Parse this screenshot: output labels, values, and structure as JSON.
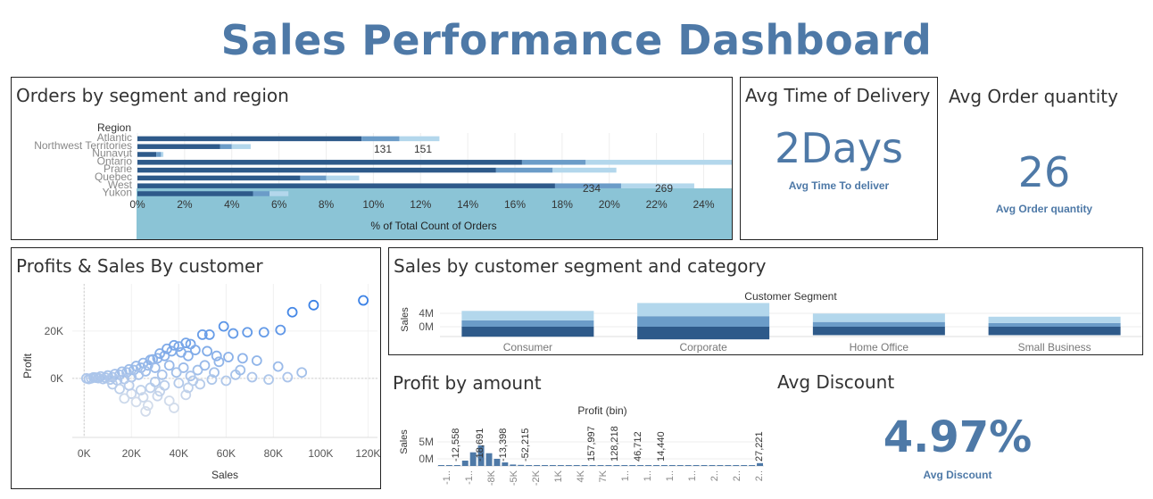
{
  "dashboard": {
    "title": "Sales Performance Dashboard"
  },
  "colors": {
    "title": "#4e79a7",
    "dark": "#2e5a8a",
    "mid": "#6b9cc8",
    "light": "#b3d7ec",
    "highlight": "#8bc4d6"
  },
  "orders_panel": {
    "title": "Orders by segment and region",
    "header": "Region",
    "axis_title": "% of Total Count of Orders",
    "chart_data": {
      "type": "bar",
      "orientation": "horizontal",
      "stacked": true,
      "categories": [
        "Atlantic",
        "Northwest Territories",
        "Nunavut",
        "Ontario",
        "Prarie",
        "Quebec",
        "West",
        "Yukon"
      ],
      "series": [
        {
          "values": [
            9.5,
            3.5,
            0.8,
            16.3,
            15.2,
            6.9,
            17.7,
            4.9
          ]
        },
        {
          "values": [
            1.6,
            0.5,
            0.2,
            2.7,
            2.4,
            1.1,
            2.8,
            0.7
          ]
        },
        {
          "values": [
            1.7,
            0.8,
            0.1,
            6.8,
            2.7,
            1.4,
            3.1,
            0.8
          ]
        }
      ],
      "data_labels": [
        {
          "category": "Northwest Territories",
          "labels": [
            "131",
            "151"
          ]
        },
        {
          "category": "West",
          "labels": [
            "234",
            "269"
          ]
        }
      ],
      "xticks": [
        "0%",
        "2%",
        "4%",
        "6%",
        "8%",
        "10%",
        "12%",
        "14%",
        "16%",
        "18%",
        "20%",
        "22%",
        "24%"
      ],
      "xlim": [
        0,
        24.7
      ],
      "xlabel": "% of Total Count of Orders"
    }
  },
  "delivery_panel": {
    "title": "Avg Time of Delivery",
    "value": "2Days",
    "caption": "Avg Time To deliver"
  },
  "quantity_panel": {
    "title": "Avg Order quantity",
    "value": "26",
    "caption": "Avg Order quantity"
  },
  "profits_panel": {
    "title": "Profits & Sales By customer",
    "chart_data": {
      "type": "scatter",
      "xlabel": "Sales",
      "ylabel": "Profit",
      "xticks": [
        "0K",
        "20K",
        "40K",
        "60K",
        "80K",
        "100K",
        "120K"
      ],
      "yticks": [
        "20K",
        "0K"
      ],
      "xlim": [
        -5000,
        124000
      ],
      "ylim": [
        -25000,
        40000
      ],
      "points": [
        [
          118000,
          33000
        ],
        [
          97000,
          31000
        ],
        [
          88000,
          28000
        ],
        [
          83000,
          20500
        ],
        [
          76000,
          19500
        ],
        [
          69000,
          19500
        ],
        [
          63000,
          19000
        ],
        [
          59000,
          22000
        ],
        [
          53000,
          18500
        ],
        [
          50000,
          18500
        ],
        [
          45000,
          14500
        ],
        [
          43000,
          15000
        ],
        [
          40000,
          13500
        ],
        [
          37000,
          11500
        ],
        [
          34000,
          9500
        ],
        [
          31000,
          8500
        ],
        [
          29000,
          8000
        ],
        [
          27000,
          5500
        ],
        [
          24000,
          4500
        ],
        [
          21000,
          3500
        ],
        [
          18000,
          2500
        ],
        [
          15000,
          1500
        ],
        [
          12000,
          500
        ],
        [
          9000,
          300
        ],
        [
          6000,
          100
        ],
        [
          3000,
          0
        ],
        [
          1000,
          0
        ],
        [
          2000,
          -300
        ],
        [
          4000,
          400
        ],
        [
          7000,
          800
        ],
        [
          10000,
          1200
        ],
        [
          13000,
          1800
        ],
        [
          16000,
          2800
        ],
        [
          19000,
          3800
        ],
        [
          22000,
          5200
        ],
        [
          25000,
          6500
        ],
        [
          28000,
          7800
        ],
        [
          32000,
          10500
        ],
        [
          35000,
          12500
        ],
        [
          38000,
          14000
        ],
        [
          41000,
          11000
        ],
        [
          44000,
          9500
        ],
        [
          47000,
          12000
        ],
        [
          52000,
          11500
        ],
        [
          56000,
          9500
        ],
        [
          61000,
          9000
        ],
        [
          67000,
          8500
        ],
        [
          73000,
          7500
        ],
        [
          82000,
          5000
        ],
        [
          92000,
          2500
        ],
        [
          86000,
          500
        ],
        [
          78000,
          -500
        ],
        [
          71000,
          500
        ],
        [
          64000,
          1500
        ],
        [
          55000,
          2500
        ],
        [
          48000,
          3500
        ],
        [
          42000,
          4500
        ],
        [
          36000,
          5500
        ],
        [
          30000,
          4500
        ],
        [
          26000,
          3000
        ],
        [
          23000,
          1500
        ],
        [
          20000,
          500
        ],
        [
          17000,
          -300
        ],
        [
          14000,
          -800
        ],
        [
          11000,
          -500
        ],
        [
          8000,
          -300
        ],
        [
          5000,
          300
        ],
        [
          33000,
          1500
        ],
        [
          39000,
          2500
        ],
        [
          45000,
          1000
        ],
        [
          51000,
          5500
        ],
        [
          57000,
          7000
        ],
        [
          66000,
          3500
        ],
        [
          46000,
          -1000
        ],
        [
          40000,
          -2000
        ],
        [
          34000,
          -3000
        ],
        [
          28000,
          -4000
        ],
        [
          24000,
          -5000
        ],
        [
          20000,
          -6500
        ],
        [
          17000,
          -8500
        ],
        [
          22000,
          -10000
        ],
        [
          27000,
          -11500
        ],
        [
          31000,
          -7500
        ],
        [
          36000,
          -9500
        ],
        [
          43000,
          -7000
        ],
        [
          38000,
          -12500
        ],
        [
          26000,
          -14000
        ],
        [
          32000,
          -5500
        ],
        [
          25000,
          -8000
        ],
        [
          19000,
          -3000
        ],
        [
          15000,
          -4500
        ],
        [
          12000,
          -2500
        ],
        [
          30000,
          -1500
        ],
        [
          44000,
          -4000
        ],
        [
          49000,
          -2500
        ],
        [
          54000,
          -500
        ],
        [
          60000,
          -1000
        ]
      ]
    }
  },
  "segment_panel": {
    "title": "Sales by customer segment and category",
    "header": "Customer Segment",
    "chart_data": {
      "type": "bar",
      "stacked": true,
      "categories": [
        "Consumer",
        "Corporate",
        "Home Office",
        "Small Business"
      ],
      "ylabel": "Sales",
      "yticks": [
        "4M",
        "0M"
      ],
      "ylim": [
        -2.0,
        5.0
      ],
      "series": [
        {
          "values": [
            -1.9,
            -2.4,
            -1.6,
            -1.6
          ]
        },
        {
          "values": [
            1.2,
            2.0,
            0.9,
            0.7
          ]
        },
        {
          "values": [
            1.8,
            2.5,
            1.6,
            1.2
          ]
        }
      ]
    }
  },
  "profit_amount_panel": {
    "title": "Profit by amount",
    "header": "Profit (bin)",
    "chart_data": {
      "type": "bar",
      "ylabel": "Sales",
      "yticks": [
        "5M",
        "0M"
      ],
      "ylim": [
        0,
        8
      ],
      "values": [
        0.05,
        0.1,
        0.2,
        1.5,
        4.5,
        6.8,
        4.2,
        2.0,
        1.0,
        0.4,
        0.3,
        0.15,
        0.2,
        0.1,
        0.08,
        0.05,
        0.05,
        0.03,
        0.02,
        0.03,
        0.01,
        0.01,
        0.02,
        0.01,
        0.01,
        0.01,
        0.01,
        0.02,
        0.01,
        0.01,
        0.01,
        0.03,
        0.02,
        0.01,
        0.01,
        0.01,
        0.01,
        0.02,
        0.01,
        0.01,
        0.8
      ],
      "bar_labels": [
        "-12,558",
        "-18,691",
        "-13,398",
        "-52,215",
        "157,997",
        "128,218",
        "46,712",
        "14,440",
        "27,221"
      ],
      "xticks": [
        "-1..",
        "-1..",
        "-8K",
        "-5K",
        "-2K",
        "1K",
        "4K",
        "7K",
        "1..",
        "1..",
        "1..",
        "1..",
        "2..",
        "2..",
        "2.."
      ]
    }
  },
  "discount_panel": {
    "title": "Avg Discount",
    "value": "4.97%",
    "caption": "Avg Discount"
  }
}
